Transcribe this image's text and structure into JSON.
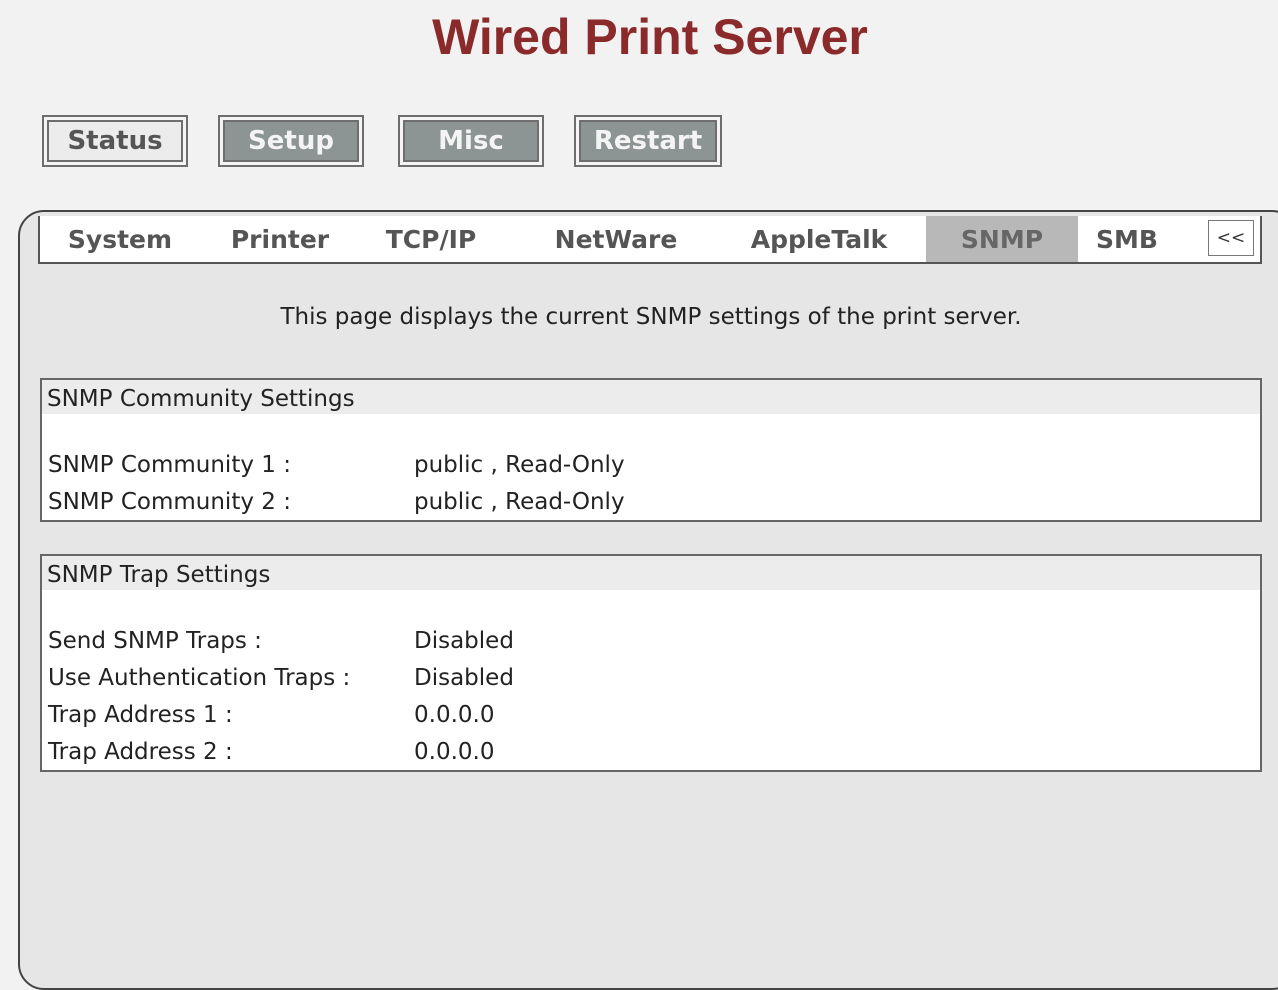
{
  "title": "Wired Print Server",
  "topnav": {
    "status": "Status",
    "setup": "Setup",
    "misc": "Misc",
    "restart": "Restart"
  },
  "tabs": {
    "system": "System",
    "printer": "Printer",
    "tcpip": "TCP/IP",
    "netware": "NetWare",
    "appletalk": "AppleTalk",
    "snmp": "SNMP",
    "smb": "SMB",
    "more": "<<"
  },
  "description": "This page displays the current SNMP settings of the print server.",
  "community": {
    "header": "SNMP Community Settings",
    "rows": [
      {
        "label": "SNMP Community 1 :",
        "value": "public , Read-Only"
      },
      {
        "label": "SNMP Community 2 :",
        "value": "public , Read-Only"
      }
    ]
  },
  "trap": {
    "header": "SNMP Trap Settings",
    "rows": [
      {
        "label": "Send SNMP Traps :",
        "value": "Disabled"
      },
      {
        "label": "Use Authentication Traps :",
        "value": "Disabled"
      },
      {
        "label": "Trap Address 1 :",
        "value": "0.0.0.0"
      },
      {
        "label": "Trap Address 2 :",
        "value": "0.0.0.0"
      }
    ]
  }
}
